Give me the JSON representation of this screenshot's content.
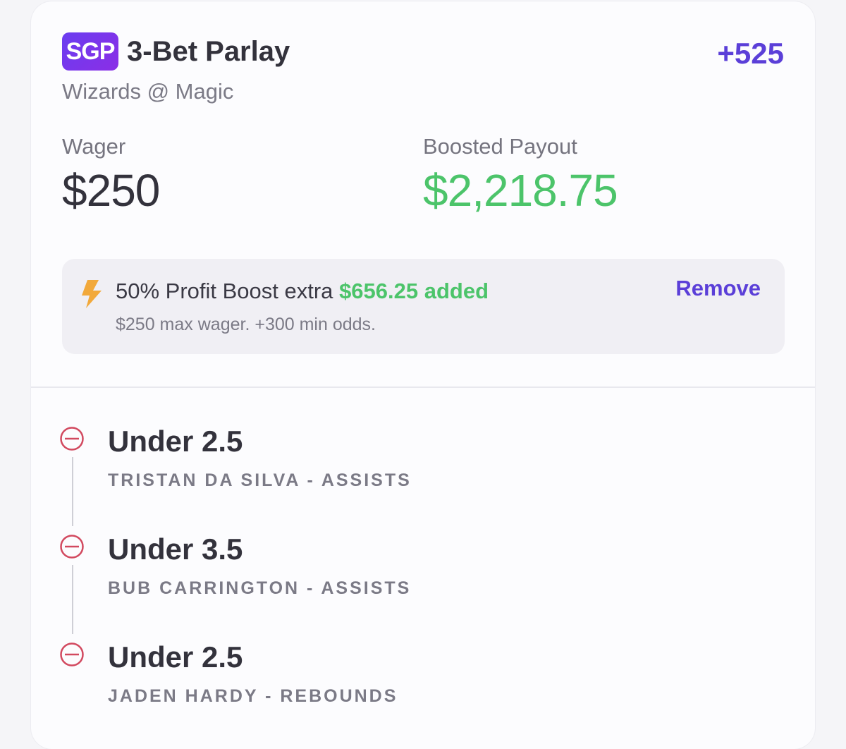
{
  "bet": {
    "badge": "SGP",
    "title": "3-Bet Parlay",
    "odds": "+525",
    "matchup": "Wizards @ Magic"
  },
  "wager": {
    "label": "Wager",
    "amount": "$250"
  },
  "payout": {
    "label": "Boosted Payout",
    "amount": "$2,218.75"
  },
  "boost": {
    "icon": "lightning-bolt-icon",
    "text": "50% Profit Boost extra",
    "added": "$656.25 added",
    "terms": "$250 max wager. +300 min odds.",
    "remove_label": "Remove"
  },
  "legs": [
    {
      "icon": "minus-circle-icon",
      "pick": "Under 2.5",
      "detail": "TRISTAN DA SILVA - ASSISTS"
    },
    {
      "icon": "minus-circle-icon",
      "pick": "Under 3.5",
      "detail": "BUB CARRINGTON - ASSISTS"
    },
    {
      "icon": "minus-circle-icon",
      "pick": "Under 2.5",
      "detail": "JADEN HARDY - REBOUNDS"
    }
  ],
  "colors": {
    "accent": "#5b3fd8",
    "payout_green": "#4cc46a",
    "leg_status_red": "#d2495f",
    "bolt_orange": "#f2a93b"
  }
}
